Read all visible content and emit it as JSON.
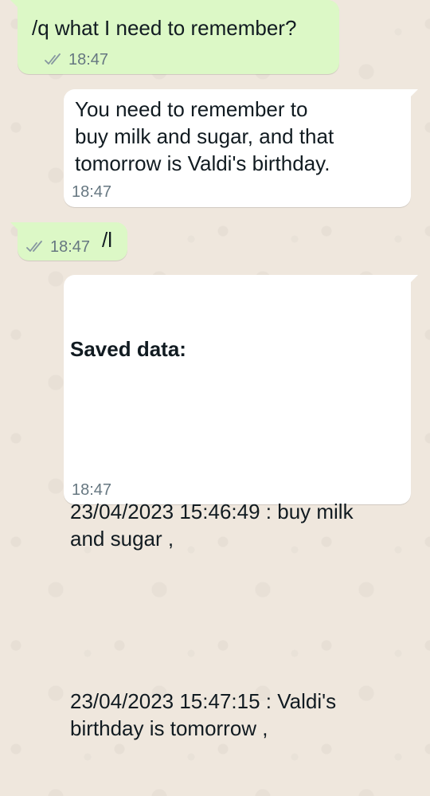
{
  "messages": [
    {
      "direction": "outgoing",
      "text": "/q what I need to remember?",
      "time": "18:47",
      "status_icon": "double-check-icon"
    },
    {
      "direction": "incoming",
      "text": "You need to remember to\nbuy milk and sugar, and that\ntomorrow is Valdi's birthday.",
      "time": "18:47"
    },
    {
      "direction": "outgoing",
      "text": "/l",
      "time": "18:47",
      "status_icon": "double-check-icon"
    },
    {
      "direction": "incoming",
      "heading": "Saved data:",
      "entries": [
        "23/04/2023 15:46:49 : buy milk\nand sugar ,",
        "23/04/2023 15:47:15 : Valdi's\nbirthday is tomorrow ,"
      ],
      "time": "18:47"
    }
  ],
  "colors": {
    "outgoing_bubble": "#dcf8c6",
    "incoming_bubble": "#ffffff",
    "chat_background": "#efe7dd",
    "meta_text": "#667781",
    "tick_color": "#8696a0"
  }
}
